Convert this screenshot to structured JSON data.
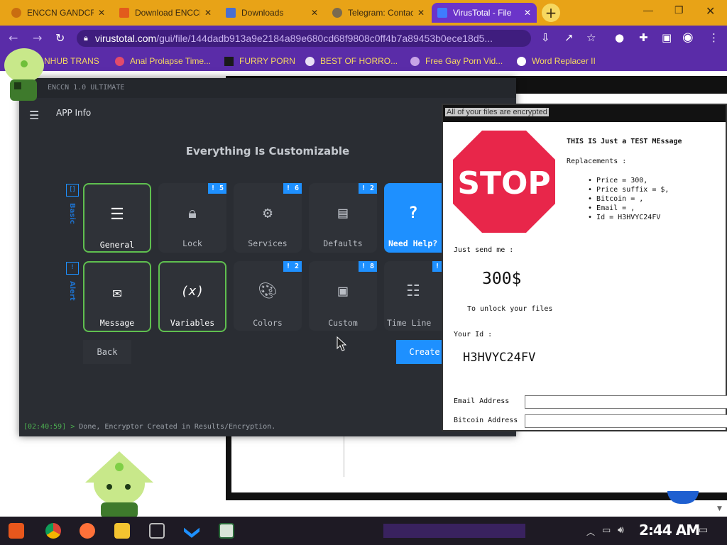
{
  "browser": {
    "tabs": [
      {
        "label": "ENCCN GANDCRAB"
      },
      {
        "label": "Download ENCCN"
      },
      {
        "label": "Downloads"
      },
      {
        "label": "Telegram: Contact"
      },
      {
        "label": "VirusTotal - File"
      }
    ],
    "new_tab": "+",
    "url_host": "virustotal.com",
    "url_path": "/gui/file/144dadb913a9e2184a89e680cd68f9808c0ff4b7a89453b0ece18d5...",
    "bookmarks": [
      "NHUB TRANS",
      "Anal Prolapse Time...",
      "FURRY PORN",
      "BEST OF HORRO...",
      "Free Gay Porn Vid...",
      "Word Replacer II"
    ],
    "accent": "#6b34c9"
  },
  "app": {
    "window_title": "ENCCN 1.0 ULTIMATE",
    "menu_title": "APP Info",
    "heading": "Everything Is Customizable",
    "rows": [
      {
        "tag": "[]",
        "label": "Basic"
      },
      {
        "tag": "!",
        "label": "Alert"
      }
    ],
    "cards": {
      "general": {
        "label": "General"
      },
      "lock": {
        "label": "Lock",
        "badge": "! 5"
      },
      "services": {
        "label": "Services",
        "badge": "! 6"
      },
      "defaults": {
        "label": "Defaults",
        "badge": "! 2"
      },
      "help": {
        "label": "Need Help?",
        "icon": "?"
      },
      "message": {
        "label": "Message"
      },
      "variables": {
        "label": "Variables",
        "icon": "(x)"
      },
      "colors": {
        "label": "Colors",
        "badge": "! 2"
      },
      "custom": {
        "label": "Custom",
        "badge": "! 8"
      },
      "timeline": {
        "label": "Time Line",
        "badge": "!"
      }
    },
    "back_label": "Back",
    "create_label": "Create",
    "status_time": "[02:40:59] >",
    "status_message": "Done, Encryptor Created in Results/Encryption."
  },
  "note": {
    "title": "All of your files are encrypted",
    "stop_text": "STOP",
    "test_message": "THIS IS Just a TEST MEssage",
    "replacements_label": "Replacements :",
    "replacements": [
      "Price = 300,",
      "Price suffix = $,",
      "Bitcoin = ,",
      "Email = ,",
      "Id = H3HVYC24FV"
    ],
    "send_label": "Just send me :",
    "amount": "300$",
    "unlock_text": "To unlock your files",
    "id_label": "Your Id :",
    "id_value": "H3HVYC24FV",
    "email_label": "Email Address",
    "bitcoin_label": "Bitcoin Address"
  },
  "taskbar": {
    "clock": "2:44 AM"
  }
}
